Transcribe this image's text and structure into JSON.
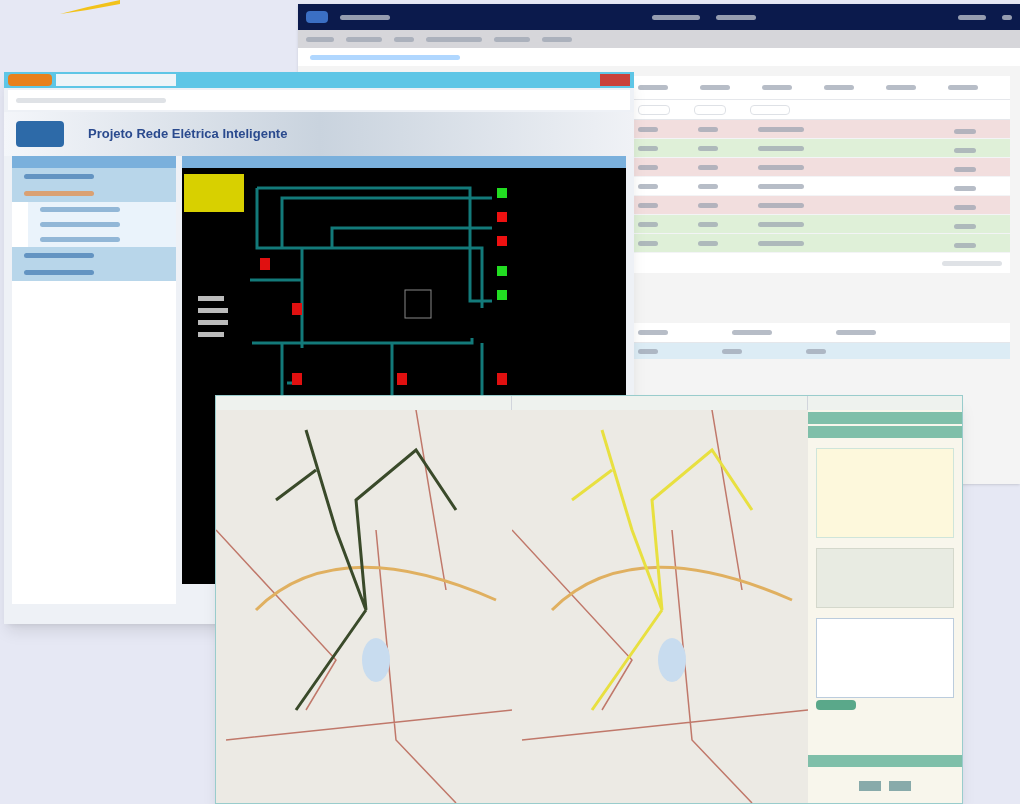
{
  "portal_window": {
    "table": {
      "rows": [
        {
          "color": "#f2dede"
        },
        {
          "color": "#dff0d8"
        },
        {
          "color": "#f2dede"
        },
        {
          "color": "#ffffff"
        },
        {
          "color": "#f2dede"
        },
        {
          "color": "#dff0d8"
        },
        {
          "color": "#dff0d8"
        }
      ]
    }
  },
  "browser_window": {
    "page_title": "Projeto Rede Elétrica Inteligente",
    "sidebar": {
      "items": [
        {
          "selected": false
        },
        {
          "selected": true,
          "children": [
            {
              "selected": false
            },
            {
              "selected": false
            },
            {
              "selected": false
            }
          ]
        },
        {
          "selected": false
        },
        {
          "selected": false
        }
      ]
    },
    "schematic": {
      "feeders": [
        {
          "color": "#22dd22"
        },
        {
          "color": "#ee1111"
        },
        {
          "color": "#ee1111"
        },
        {
          "color": "#22dd22"
        },
        {
          "color": "#22dd22"
        }
      ]
    }
  },
  "map_window": {
    "panes": [
      {
        "color": "#3a4a2a"
      },
      {
        "color": "#e8e040"
      }
    ]
  }
}
